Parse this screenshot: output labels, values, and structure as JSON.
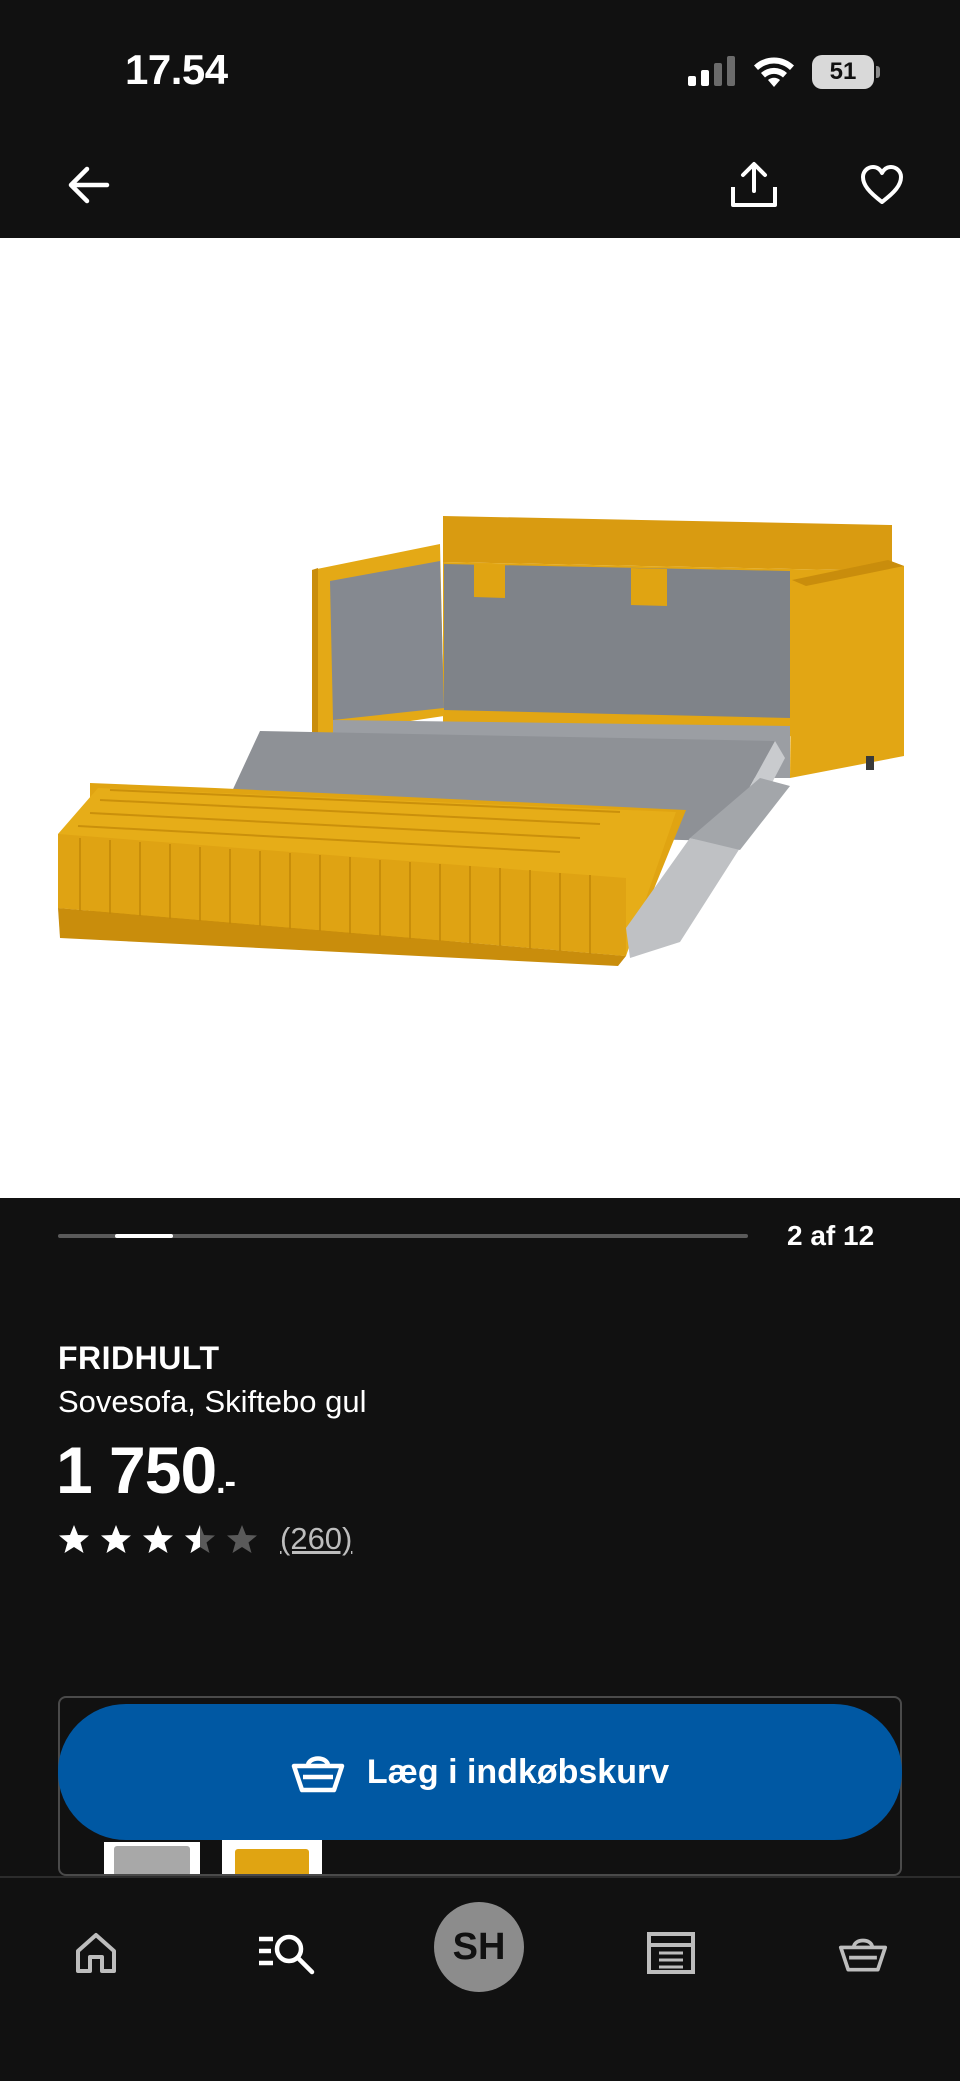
{
  "status_bar": {
    "time": "17.54",
    "battery": "51"
  },
  "toolbar": {
    "back_icon": "arrow-left-icon",
    "share_icon": "share-icon",
    "favorite_icon": "heart-icon"
  },
  "gallery": {
    "counter": "2 af 12",
    "current_index": 2,
    "total": 12
  },
  "product": {
    "brand": "FRIDHULT",
    "description": "Sovesofa, Skiftebo gul",
    "price": "1 750",
    "price_suffix": ".-",
    "rating_value": 3.5,
    "rating_max": 5,
    "review_count": "(260)"
  },
  "cart": {
    "label": "Læg i indkøbskurv",
    "color": "#0058a3"
  },
  "variants": [
    {
      "name": "grey-variant",
      "color": "#a8a8a8"
    },
    {
      "name": "yellow-variant",
      "color": "#e0a412"
    }
  ],
  "bottom_nav": {
    "home_icon": "home-icon",
    "search_icon": "search-icon",
    "profile_initials": "SH",
    "store_icon": "store-icon",
    "basket_icon": "basket-icon"
  },
  "colors": {
    "background": "#111111",
    "accent_blue": "#0058a3",
    "product_yellow": "#e0a412",
    "product_grey": "#7f8389"
  }
}
